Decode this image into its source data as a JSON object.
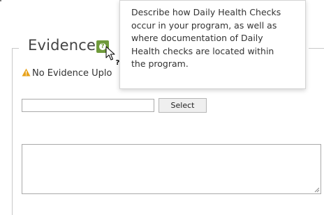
{
  "section": {
    "title": "Evidence",
    "help_icon": "question-icon"
  },
  "warning": {
    "icon": "warning-triangle-icon",
    "color": "#e8a21a",
    "text": "No Evidence Uplo"
  },
  "upload": {
    "file_value": "",
    "select_label": "Select"
  },
  "notes": {
    "value": ""
  },
  "tooltip": {
    "lines": [
      "Describe how Daily Health Checks",
      "occur in your program, as well as",
      "where documentation of Daily",
      "Health checks are located within",
      "the program."
    ]
  },
  "colors": {
    "help_button": "#6f9a3b",
    "frame": "#c8c8c8"
  }
}
